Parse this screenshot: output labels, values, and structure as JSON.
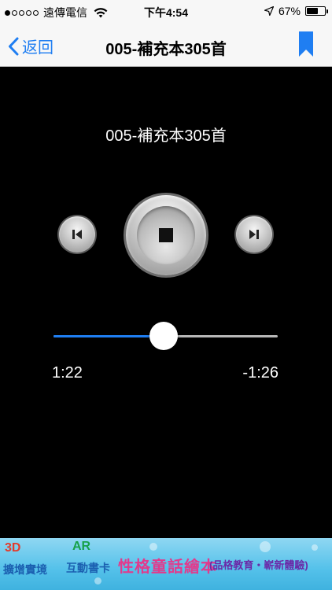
{
  "status_bar": {
    "carrier": "遠傳電信",
    "time": "下午4:54",
    "battery_percent": "67%",
    "battery_level": 0.67,
    "signal_bars_filled": 1,
    "signal_bars_total": 5
  },
  "nav": {
    "back_label": "返回",
    "title": "005-補充本305首"
  },
  "player": {
    "track_title": "005-補充本305首",
    "elapsed": "1:22",
    "remaining": "-1:26",
    "progress_fraction": 0.49
  },
  "banner": {
    "badge_3d": "3D",
    "badge_3d_sub": "擴增實境",
    "badge_ar": "AR",
    "badge_ar_sub": "互動書卡",
    "main_text": "性格童話繪本",
    "sub_text": "(品格教育・嶄新體驗)"
  },
  "colors": {
    "accent": "#1f7ef2",
    "background": "#000000",
    "bar_background": "#f7f7f7"
  }
}
